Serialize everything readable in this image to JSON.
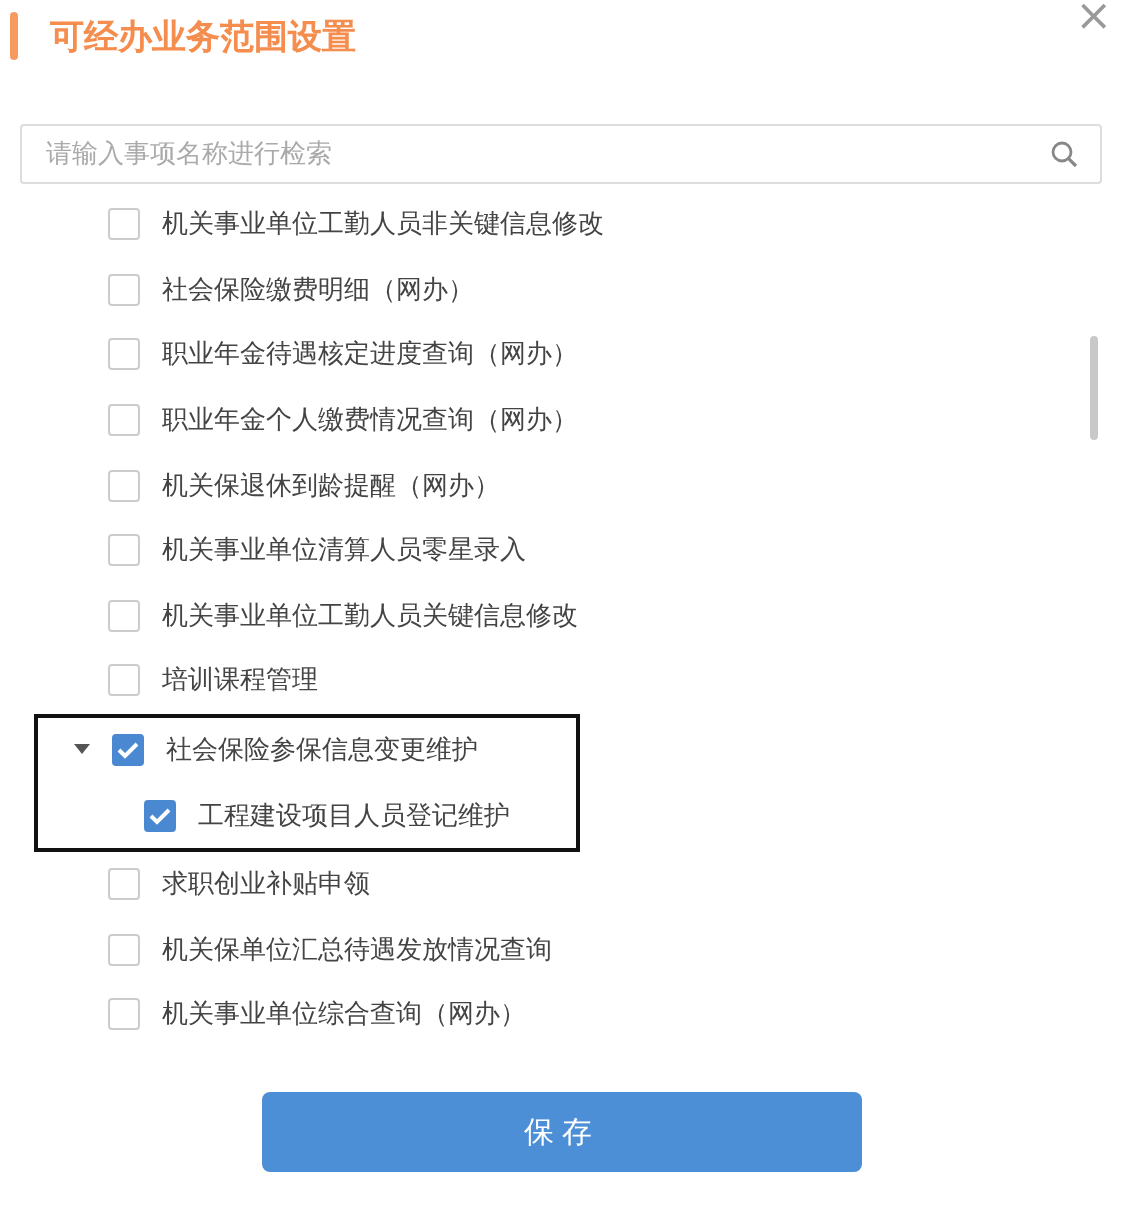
{
  "dialog": {
    "title": "可经办业务范围设置",
    "close": "×"
  },
  "search": {
    "placeholder": "请输入事项名称进行检索"
  },
  "items": [
    {
      "label": "机关事业单位工勤人员非关键信息修改",
      "checked": false
    },
    {
      "label": "社会保险缴费明细（网办）",
      "checked": false
    },
    {
      "label": "职业年金待遇核定进度查询（网办）",
      "checked": false
    },
    {
      "label": "职业年金个人缴费情况查询（网办）",
      "checked": false
    },
    {
      "label": "机关保退休到龄提醒（网办）",
      "checked": false
    },
    {
      "label": "机关事业单位清算人员零星录入",
      "checked": false
    },
    {
      "label": "机关事业单位工勤人员关键信息修改",
      "checked": false
    },
    {
      "label": "培训课程管理",
      "checked": false
    },
    {
      "label": "社会保险参保信息变更维护",
      "checked": true,
      "expanded": true,
      "highlighted": true,
      "children": [
        {
          "label": "工程建设项目人员登记维护",
          "checked": true
        }
      ]
    },
    {
      "label": "求职创业补贴申领",
      "checked": false
    },
    {
      "label": "机关保单位汇总待遇发放情况查询",
      "checked": false
    },
    {
      "label": "机关事业单位综合查询（网办）",
      "checked": false
    }
  ],
  "save_button": "保存"
}
